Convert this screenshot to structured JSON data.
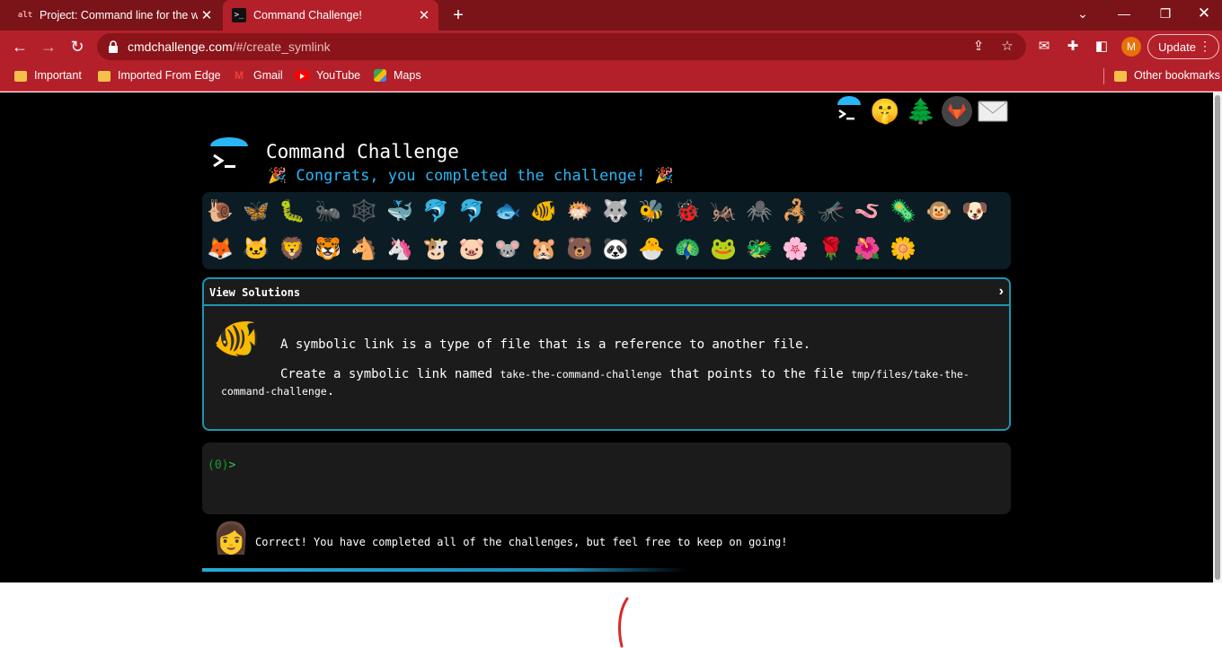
{
  "browser": {
    "tabs": [
      {
        "title": "Project: Command line for the wi",
        "favicon": "gitlab-project-icon",
        "active": false
      },
      {
        "title": "Command Challenge!",
        "favicon": "terminal-icon",
        "active": true
      }
    ],
    "url_host": "cmdchallenge.com",
    "url_path": "/#/create_symlink",
    "profile_initial": "M",
    "update_label": "Update",
    "bookmarks": [
      "Important",
      "Imported From Edge",
      "Gmail",
      "YouTube",
      "Maps"
    ],
    "other_bookmarks": "Other bookmarks",
    "colors": {
      "tabbar": "#7a1418",
      "toolbar": "#b3202a",
      "omnibox": "#8a1419"
    }
  },
  "page": {
    "title": "Command Challenge",
    "congrats_text": "Congrats, you completed the challenge!",
    "party_emoji": "🎉",
    "top_icons": [
      {
        "name": "cmdchallenge-logo-icon",
        "glyph": ""
      },
      {
        "name": "shushing-face-icon",
        "glyph": "🤫"
      },
      {
        "name": "evergreen-tree-icon",
        "glyph": "🌲"
      },
      {
        "name": "gitlab-icon",
        "glyph": "🦊"
      },
      {
        "name": "envelope-icon",
        "glyph": "✉️"
      }
    ],
    "badges_row_1": [
      "🐌",
      "🦋",
      "🐛",
      "🐜",
      "🕸️",
      "🐳",
      "🐬",
      "🐬",
      "🐟",
      "🐠",
      "🐡",
      "🐺",
      "🐝",
      "🐞",
      "🦗",
      "🕷️",
      "🦂",
      "🦟",
      "🪱",
      "🦠",
      "🐵",
      "🐶"
    ],
    "badges_row_2": [
      "🦊",
      "🐱",
      "🦁",
      "🐯",
      "🐴",
      "🦄",
      "🐮",
      "🐷",
      "🐭",
      "🐹",
      "🐻",
      "🐼",
      "🐣",
      "🦚",
      "🐸",
      "🐲",
      "🌸",
      "🌹",
      "🌺",
      "🌼"
    ],
    "view_solutions_label": "View Solutions",
    "challenge_emoji": "🐠",
    "description_1": "A symbolic link is a type of file that is a reference to another file.",
    "description_2_prefix": "Create a symbolic link named",
    "link_name": "take-the-command-challenge",
    "description_2_mid": "that points to the file",
    "target_path": "tmp/files/take-the-command-challenge",
    "description_2_suffix": ".",
    "prompt_exit_code": "(0)",
    "prompt_symbol": ">",
    "status_emoji": "👩",
    "status_text": "Correct! You have completed all of the challenges, but feel free to keep on going!",
    "progress_percent": 60,
    "colors": {
      "accent": "#29b6f6",
      "card_border": "#1e95b0",
      "prompt_green": "#2ecc40"
    }
  }
}
